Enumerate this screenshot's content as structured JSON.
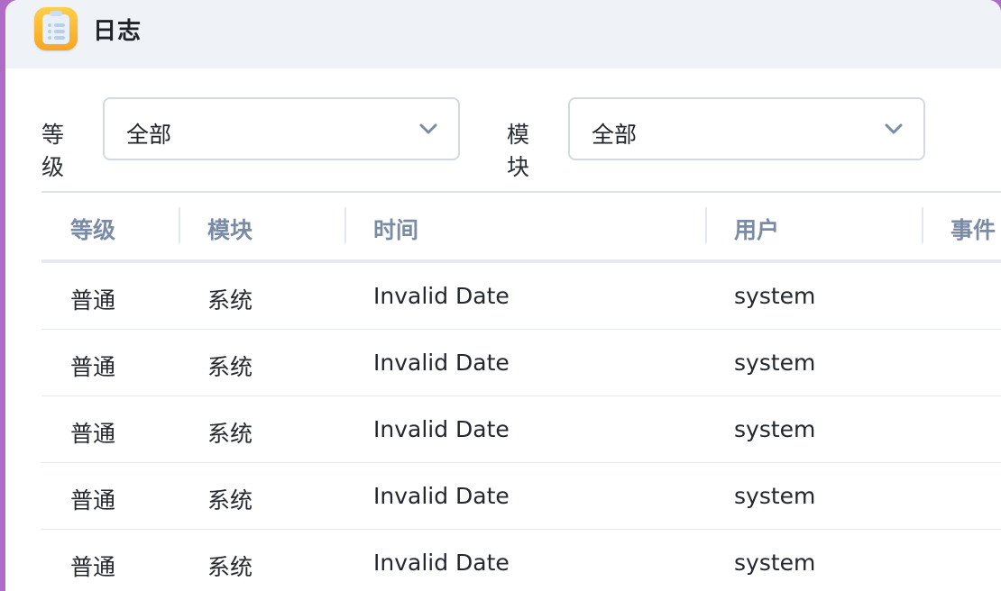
{
  "app": {
    "title": "日志",
    "icon": "clipboard-list-icon"
  },
  "filters": {
    "level": {
      "label": "等级",
      "value": "全部"
    },
    "module": {
      "label": "模块",
      "value": "全部"
    }
  },
  "table": {
    "columns": [
      "等级",
      "模块",
      "时间",
      "用户",
      "事件"
    ],
    "rows": [
      {
        "level": "普通",
        "module": "系统",
        "time": "Invalid Date",
        "user": "system"
      },
      {
        "level": "普通",
        "module": "系统",
        "time": "Invalid Date",
        "user": "system"
      },
      {
        "level": "普通",
        "module": "系统",
        "time": "Invalid Date",
        "user": "system"
      },
      {
        "level": "普通",
        "module": "系统",
        "time": "Invalid Date",
        "user": "system"
      },
      {
        "level": "普通",
        "module": "系统",
        "time": "Invalid Date",
        "user": "system"
      }
    ]
  },
  "colors": {
    "accent": "#f5a523",
    "header_text": "#7a8ba6",
    "titlebar_bg": "#eff2f7"
  }
}
